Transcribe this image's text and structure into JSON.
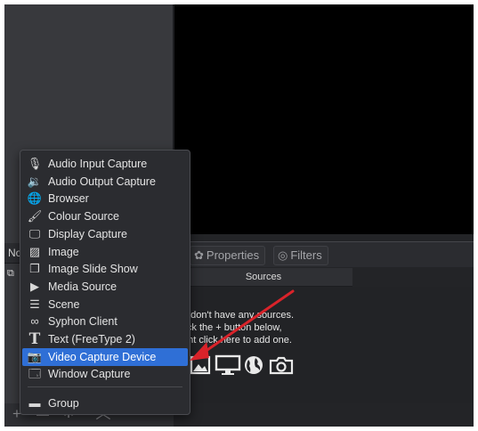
{
  "scenes": {
    "header_label": "No",
    "scene_row_icon": "display-icon"
  },
  "docks": {
    "properties_label": "Properties",
    "filters_label": "Filters",
    "sources_label": "Sources",
    "hint_line1": "u don't have any sources.",
    "hint_line2": "lick the + button below,",
    "hint_line3": "ght click here to add one."
  },
  "toolbar": {
    "add_glyph": "+",
    "remove_glyph": "—",
    "settings_glyph": "✲",
    "up_glyph": "︿",
    "down_glyph": "﹀"
  },
  "context_menu": {
    "items": [
      {
        "label": "Audio Input Capture",
        "icon": "microphone-icon"
      },
      {
        "label": "Audio Output Capture",
        "icon": "speaker-icon"
      },
      {
        "label": "Browser",
        "icon": "globe-icon"
      },
      {
        "label": "Colour Source",
        "icon": "brush-icon"
      },
      {
        "label": "Display Capture",
        "icon": "monitor-icon"
      },
      {
        "label": "Image",
        "icon": "image-icon"
      },
      {
        "label": "Image Slide Show",
        "icon": "slideshow-icon"
      },
      {
        "label": "Media Source",
        "icon": "play-icon"
      },
      {
        "label": "Scene",
        "icon": "list-icon"
      },
      {
        "label": "Syphon Client",
        "icon": "link-icon"
      },
      {
        "label": "Text (FreeType 2)",
        "icon": "text-icon"
      },
      {
        "label": "Video Capture Device",
        "icon": "camera-icon"
      },
      {
        "label": "Window Capture",
        "icon": "window-icon"
      },
      {
        "label": "Group",
        "icon": "folder-icon"
      }
    ],
    "highlighted_item": "Video Capture Device"
  },
  "colors": {
    "highlight": "#2f6fd6",
    "annotation_arrow": "#d9232a"
  }
}
